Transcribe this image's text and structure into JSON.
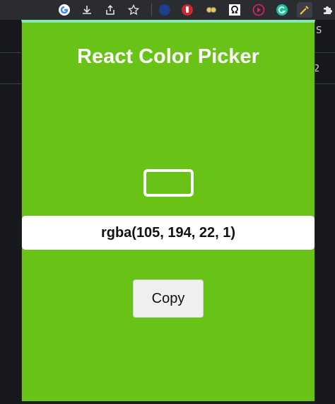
{
  "browser": {
    "toolbar_icons": [
      "google-icon",
      "download-icon",
      "share-icon",
      "star-icon",
      "extension-icon",
      "hand-icon",
      "reader-icon",
      "omega-icon",
      "play-icon",
      "grammarly-icon",
      "color-picker-icon",
      "puzzle-icon"
    ],
    "bg_tab_text": "S",
    "bg_num": "2"
  },
  "popup": {
    "title": "React Color Picker",
    "color_value": "rgba(105, 194, 22, 1)",
    "copy_label": "Copy",
    "background_color": "#69c216",
    "accent_color": "#86e8b0"
  }
}
